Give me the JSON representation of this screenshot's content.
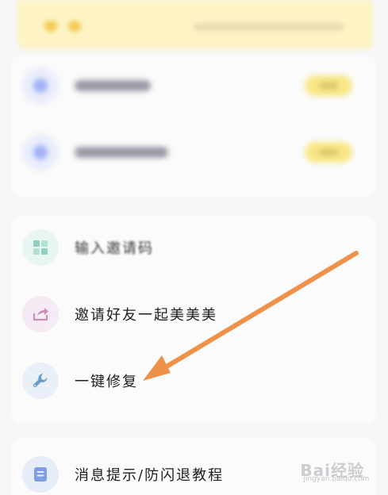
{
  "banner": {
    "icon": "yellow-dots-icon"
  },
  "top_card": {
    "rows": [
      {
        "icon": "circle-blue-icon",
        "color": "#9fb0f5"
      },
      {
        "icon": "circle-blue-icon",
        "color": "#9fb0f5"
      }
    ]
  },
  "menu": {
    "items": [
      {
        "label": "输入邀请码",
        "icon": "grid-icon",
        "icon_bg": "#e8f6f3",
        "icon_color": "#8fcfbd"
      },
      {
        "label": "邀请好友一起美美美",
        "icon": "share-icon",
        "icon_bg": "#f6eaf4",
        "icon_color": "#c98fb8"
      },
      {
        "label": "一键修复",
        "icon": "wrench-icon",
        "icon_bg": "#eaf0f7",
        "icon_color": "#6a9cc8"
      }
    ]
  },
  "bottom_item": {
    "label": "消息提示/防闪退教程",
    "icon": "document-icon",
    "icon_bg": "#e6edf8",
    "icon_color": "#7d9ee0"
  },
  "annotation": {
    "arrow_color": "#f0914a"
  },
  "watermark": {
    "text": "Bai经验",
    "sub": "jingyan.baidu.com"
  }
}
